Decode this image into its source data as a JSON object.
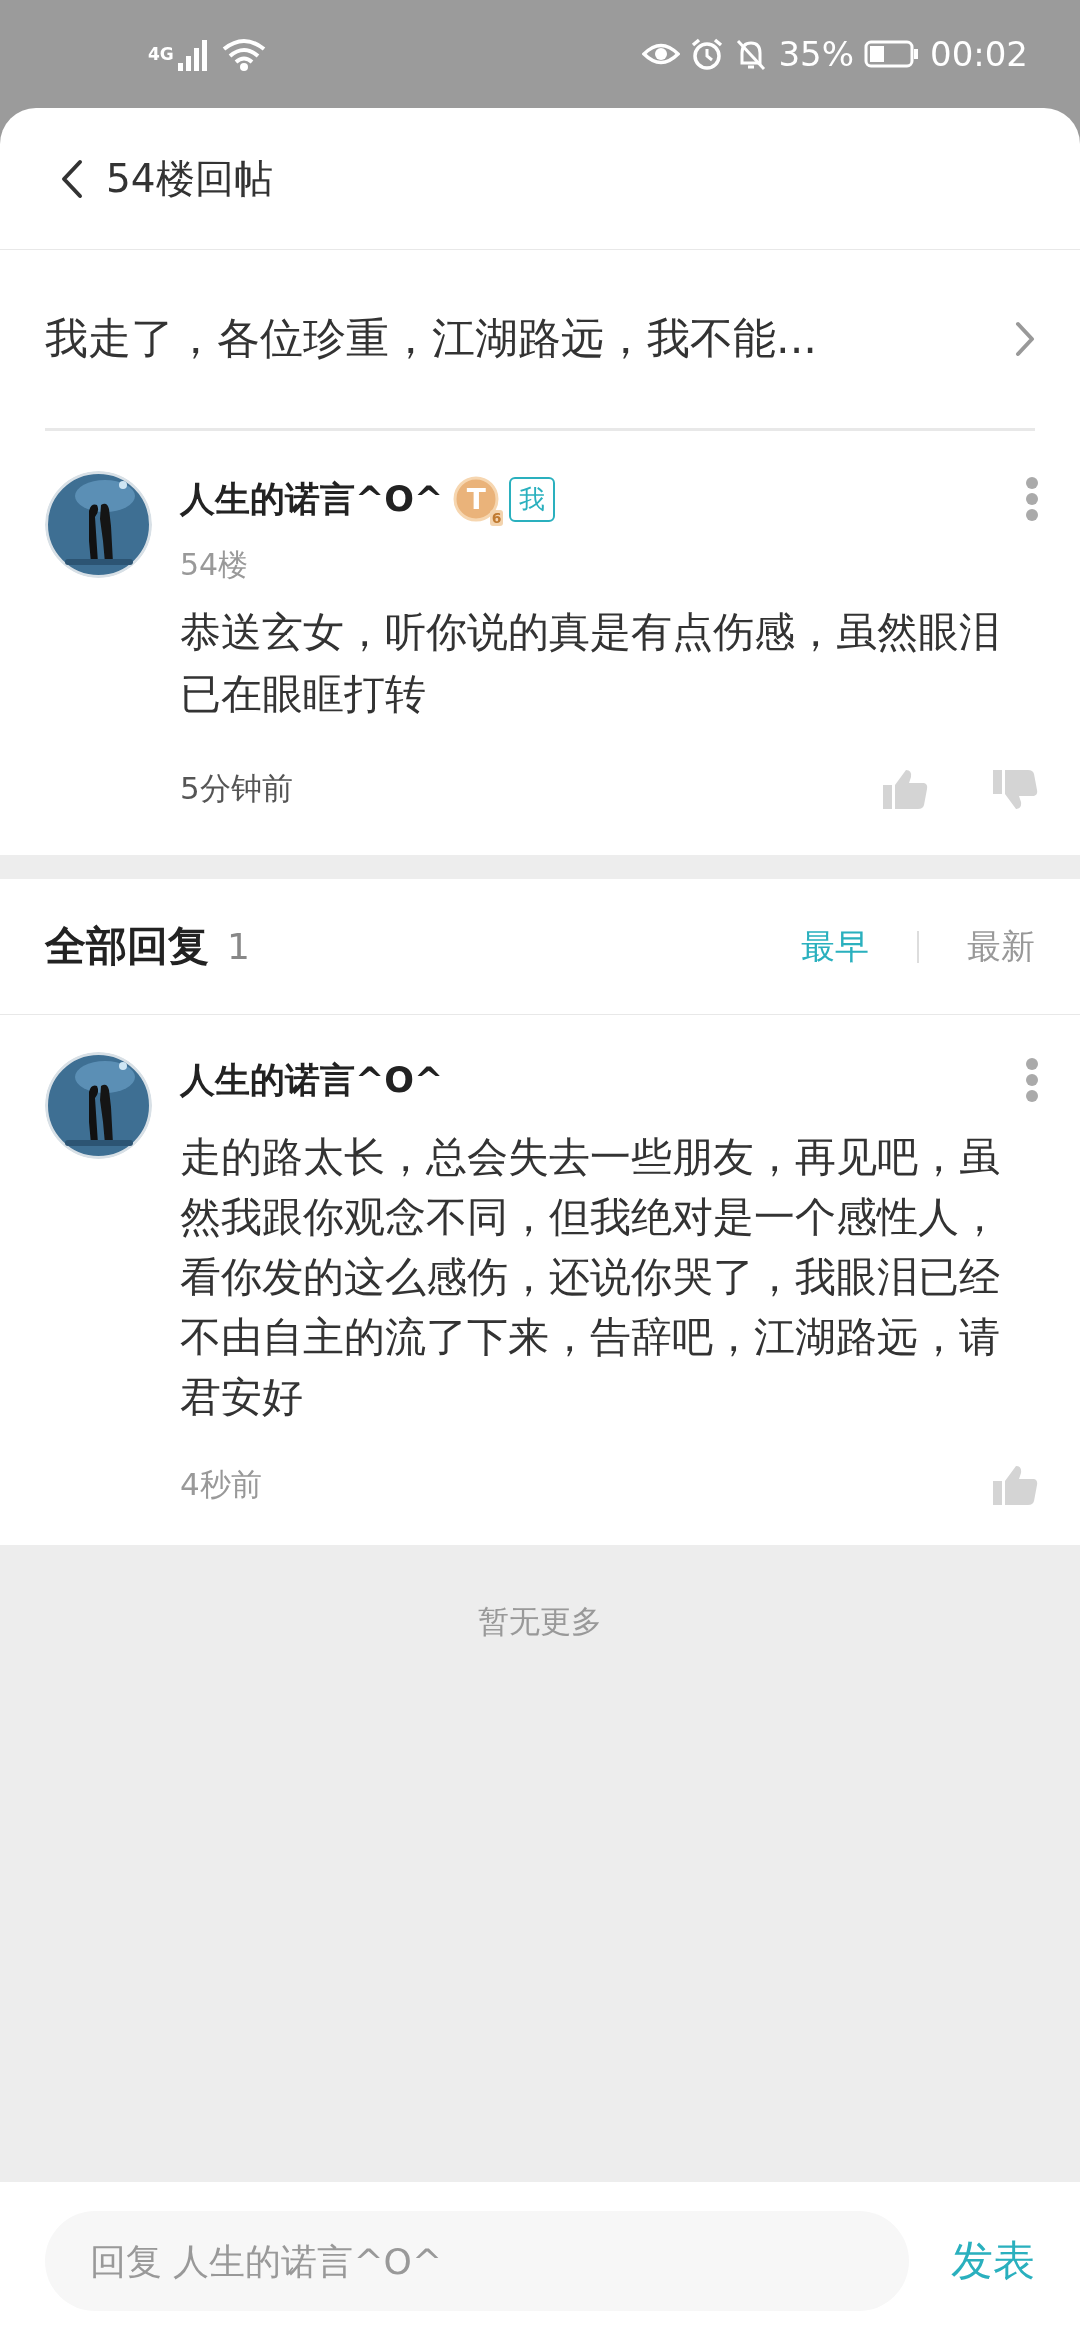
{
  "status_bar": {
    "network": "4G",
    "battery": "35%",
    "time": "00:02"
  },
  "header": {
    "title": "54楼回帖"
  },
  "post_link": {
    "text": "我走了，各位珍重，江湖路远，我不能..."
  },
  "post": {
    "author": "人生的诺言^O^",
    "badge": {
      "letter": "T",
      "level": "6"
    },
    "tag": "我",
    "floor": "54楼",
    "content": "恭送玄女，听你说的真是有点伤感，虽然眼泪已在眼眶打转",
    "time": "5分钟前"
  },
  "replies_header": {
    "title": "全部回复",
    "count": "1",
    "sort_tabs": [
      {
        "label": "最早",
        "selected": true
      },
      {
        "label": "最新",
        "selected": false
      }
    ]
  },
  "replies": [
    {
      "author": "人生的诺言^O^",
      "content": "走的路太长，总会失去一些朋友，再见吧，虽然我跟你观念不同，但我绝对是一个感性人，看你发的这么感伤，还说你哭了，我眼泪已经不由自主的流了下来，告辞吧，江湖路远，请君安好",
      "time": "4秒前"
    }
  ],
  "footer_note": "暂无更多",
  "reply_bar": {
    "placeholder": "回复 人生的诺言^O^",
    "send": "发表"
  }
}
